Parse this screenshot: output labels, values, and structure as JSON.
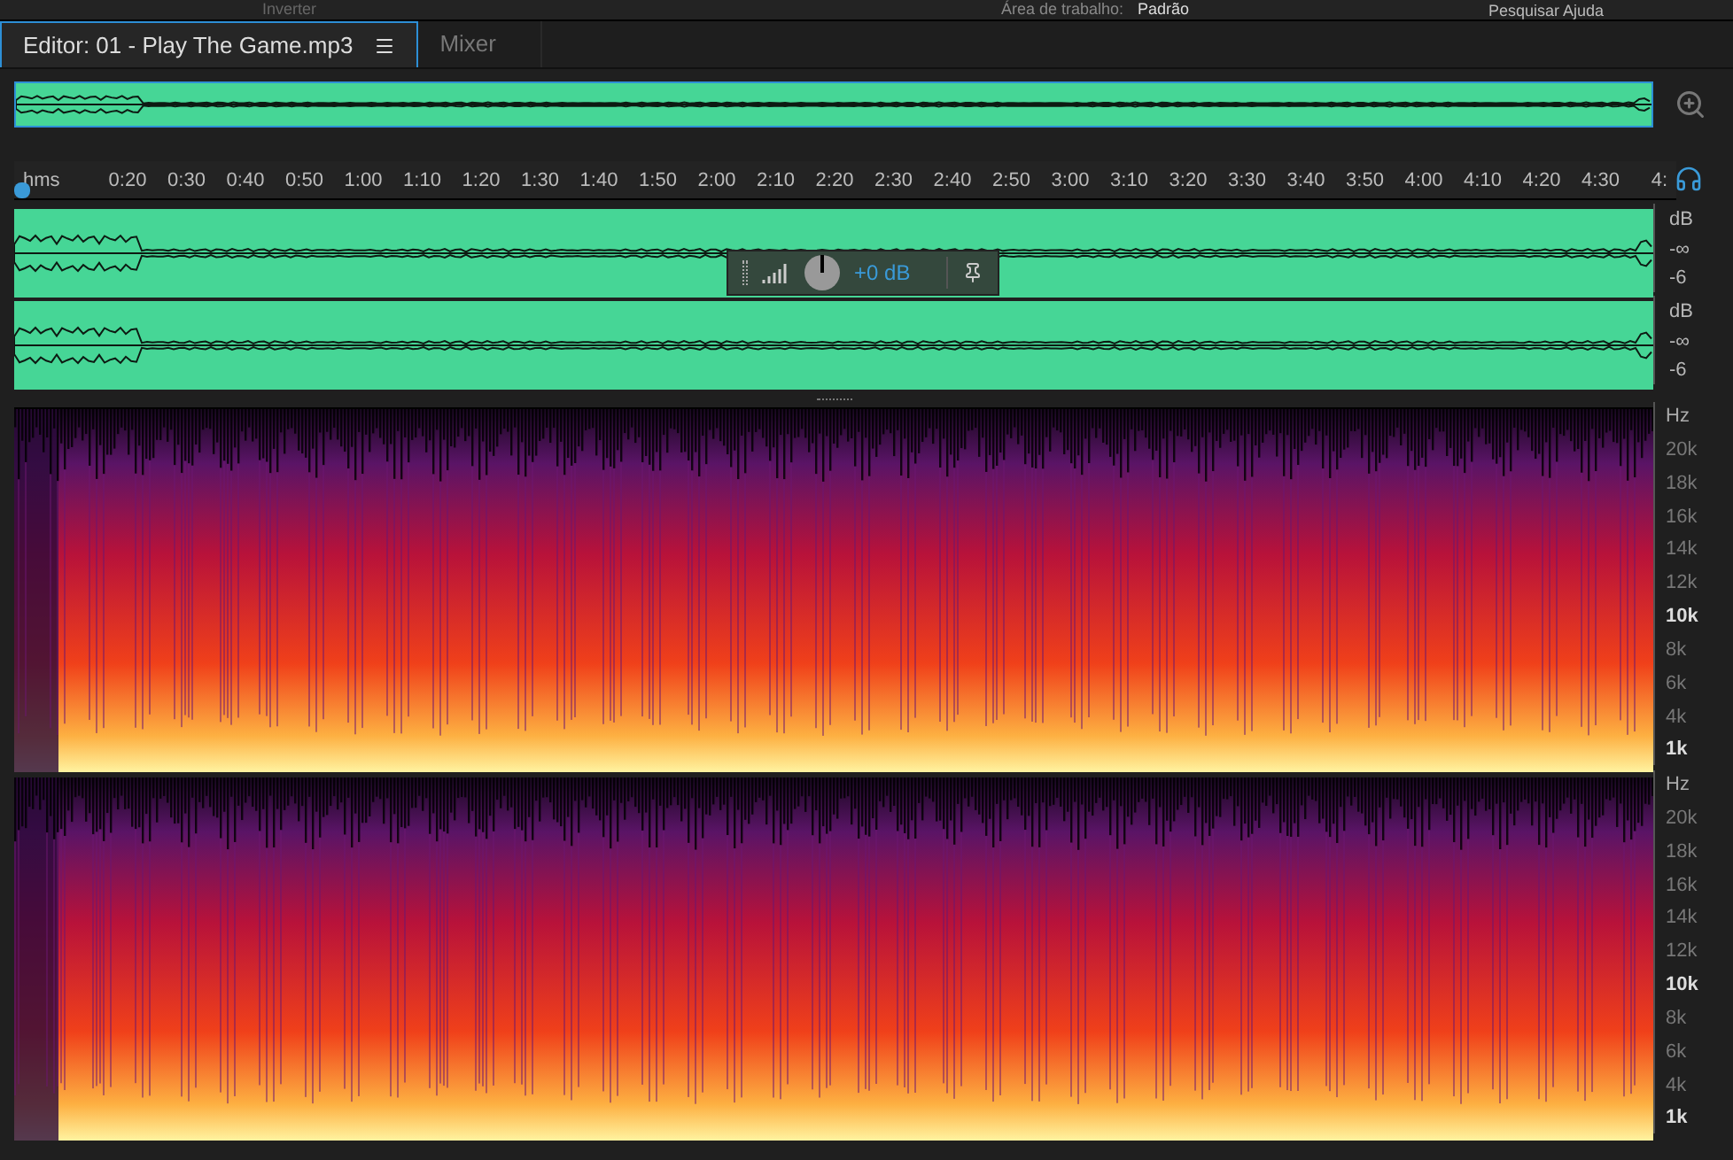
{
  "menu_bar": {
    "tool": "Inverter",
    "workspace_label": "Área de trabalho:",
    "workspace": "Padrão",
    "search_placeholder": "Pesquisar Ajuda"
  },
  "tabs": [
    {
      "label": "Editor: 01 - Play The Game.mp3",
      "selected": true,
      "has_menu": true
    },
    {
      "label": "Mixer",
      "selected": false,
      "has_menu": false
    }
  ],
  "ruler": {
    "unit": "hms",
    "labels": [
      "0:20",
      "0:30",
      "0:40",
      "0:50",
      "1:00",
      "1:10",
      "1:20",
      "1:30",
      "1:40",
      "1:50",
      "2:00",
      "2:10",
      "2:20",
      "2:30",
      "2:40",
      "2:50",
      "3:00",
      "3:10",
      "3:20",
      "3:30",
      "3:40",
      "3:50",
      "4:00",
      "4:10",
      "4:20",
      "4:30",
      "4:"
    ]
  },
  "hud": {
    "gain": "+0 dB"
  },
  "channels": [
    {
      "unit": "dB",
      "labels": [
        "-∞",
        "-6"
      ]
    },
    {
      "unit": "dB",
      "labels": [
        "-∞",
        "-6"
      ]
    }
  ],
  "spectral_channels": [
    {
      "unit": "Hz",
      "labels": [
        {
          "text": "20k",
          "emphasized": false
        },
        {
          "text": "18k",
          "emphasized": false
        },
        {
          "text": "16k",
          "emphasized": false
        },
        {
          "text": "14k",
          "emphasized": false
        },
        {
          "text": "12k",
          "emphasized": false
        },
        {
          "text": "10k",
          "emphasized": true
        },
        {
          "text": "8k",
          "emphasized": false
        },
        {
          "text": "6k",
          "emphasized": false
        },
        {
          "text": "4k",
          "emphasized": false
        },
        {
          "text": "1k",
          "emphasized": true
        }
      ]
    },
    {
      "unit": "Hz",
      "labels": [
        {
          "text": "20k",
          "emphasized": false
        },
        {
          "text": "18k",
          "emphasized": false
        },
        {
          "text": "16k",
          "emphasized": false
        },
        {
          "text": "14k",
          "emphasized": false
        },
        {
          "text": "12k",
          "emphasized": false
        },
        {
          "text": "10k",
          "emphasized": true
        },
        {
          "text": "8k",
          "emphasized": false
        },
        {
          "text": "6k",
          "emphasized": false
        },
        {
          "text": "4k",
          "emphasized": false
        },
        {
          "text": "1k",
          "emphasized": true
        }
      ]
    }
  ]
}
